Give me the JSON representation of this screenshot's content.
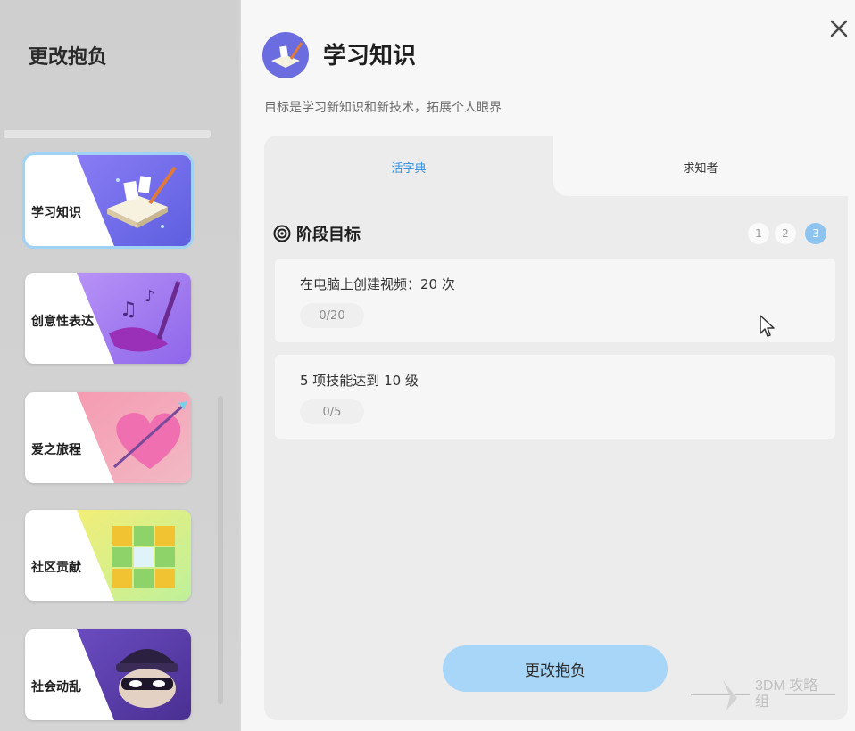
{
  "sidebar": {
    "title": "更改抱负",
    "items": [
      {
        "label": "学习知识",
        "selected": true,
        "theme": "book-quill",
        "accent": "#7c6df0"
      },
      {
        "label": "创意性表达",
        "selected": false,
        "theme": "music-brush",
        "accent": "#9b59f0"
      },
      {
        "label": "爱之旅程",
        "selected": false,
        "theme": "heart-arrow",
        "accent": "#f08aa0"
      },
      {
        "label": "社区贡献",
        "selected": false,
        "theme": "puzzle-blocks",
        "accent": "#c9ec6a"
      },
      {
        "label": "社会动乱",
        "selected": false,
        "theme": "masked-thief",
        "accent": "#5a3fa8"
      }
    ]
  },
  "header": {
    "icon": "book-icon",
    "title": "学习知识",
    "subtitle": "目标是学习新知识和新技术，拓展个人眼界"
  },
  "tabs": [
    {
      "label": "活字典",
      "active": true
    },
    {
      "label": "求知者",
      "active": false
    }
  ],
  "stage": {
    "title": "阶段目标",
    "steps": [
      {
        "label": "1",
        "active": false
      },
      {
        "label": "2",
        "active": false
      },
      {
        "label": "3",
        "active": true
      }
    ]
  },
  "goals": [
    {
      "text": "在电脑上创建视频：20 次",
      "progress": "0/20"
    },
    {
      "text": "5 项技能达到 10 级",
      "progress": "0/5"
    }
  ],
  "primary_button": "更改抱负",
  "watermark": "3DM 攻略组",
  "colors": {
    "accent_blue": "#2d8ee6",
    "button_bg": "#a8d6f8",
    "step_active": "#8cc4ef"
  }
}
